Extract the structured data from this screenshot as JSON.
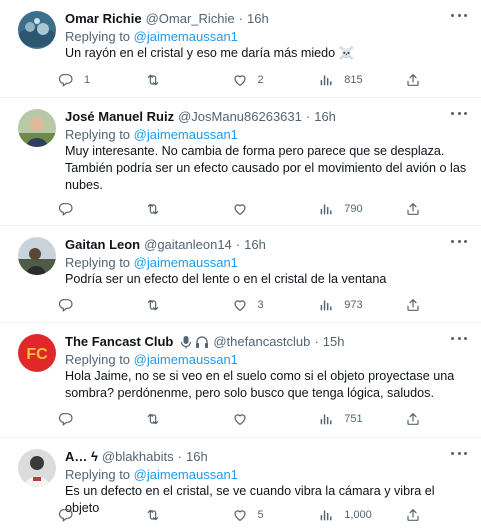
{
  "replying_prefix": "Replying to ",
  "tweets": [
    {
      "name": "Omar Richie",
      "handle": "@Omar_Richie",
      "sep": "·",
      "time": "16h",
      "reply_to": "@jaimemaussan1",
      "text": "Un rayón en el cristal y eso me daría más miedo ☠️",
      "replies": "1",
      "retweets": "",
      "likes": "2",
      "views": "815"
    },
    {
      "name": "José Manuel Ruiz",
      "handle": "@JosManu86263631",
      "sep": "·",
      "time": "16h",
      "reply_to": "@jaimemaussan1",
      "text": "Muy interesante. No cambia de forma pero parece que se desplaza. También podría ser un efecto causado por el movimiento del avión o las nubes.",
      "replies": "",
      "retweets": "",
      "likes": "",
      "views": "790"
    },
    {
      "name": "Gaitan Leon",
      "handle": "@gaitanleon14",
      "sep": "·",
      "time": "16h",
      "reply_to": "@jaimemaussan1",
      "text": "Podría ser un efecto del lente o en el cristal de la ventana",
      "replies": "",
      "retweets": "",
      "likes": "3",
      "views": "973"
    },
    {
      "name": "The Fancast Club",
      "handle": "@thefancastclub",
      "sep": "·",
      "time": "15h",
      "reply_to": "@jaimemaussan1",
      "text": "Hola Jaime, no se si veo en el suelo como si el objeto proyectase una sombra? perdónenme, pero solo busco que tenga lógica, saludos.",
      "replies": "",
      "retweets": "",
      "likes": "",
      "views": "751"
    },
    {
      "name": "A… ϟ",
      "handle": "@blakhabits",
      "sep": "·",
      "time": "16h",
      "reply_to": "@jaimemaussan1",
      "text": "Es un defecto en el cristal, se ve cuando vibra la cámara y vibra el objeto",
      "replies": "",
      "retweets": "",
      "likes": "5",
      "views": "1,000"
    }
  ],
  "icons": {
    "reply": "reply-icon",
    "retweet": "retweet-icon",
    "like": "like-icon",
    "views": "views-icon",
    "share": "share-icon",
    "more": "more-icon",
    "mic": "microphone-icon",
    "headphones": "headphones-icon"
  },
  "colors": {
    "accent": "#1d9bf0",
    "secondary_text": "#536471",
    "primary_text": "#0f1419",
    "divider": "#eff3f4",
    "fancast_logo_bg": "#e0282b",
    "fancast_logo_text": "#f6c23a"
  },
  "logo": {
    "fancast": "FC"
  }
}
